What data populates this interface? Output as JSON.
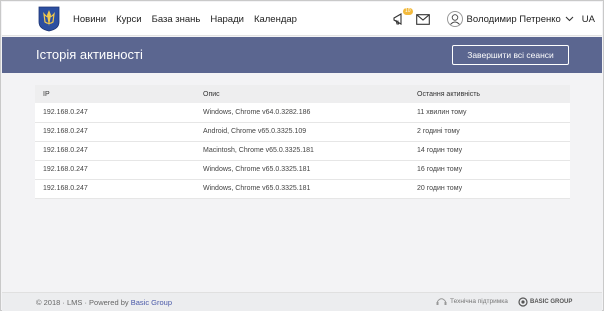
{
  "header": {
    "nav": [
      "Новини",
      "Курси",
      "База знань",
      "Наради",
      "Календар"
    ],
    "notifications_count": "10",
    "user_name": "Володимир Петренко",
    "lang": "UA"
  },
  "banner": {
    "title": "Історія активності",
    "end_sessions_label": "Завершити всі сеанси"
  },
  "table": {
    "headers": [
      "IP",
      "Опис",
      "Остання активність"
    ],
    "rows": [
      [
        "192.168.0.247",
        "Windows, Chrome v64.0.3282.186",
        "11 хвилин тому"
      ],
      [
        "192.168.0.247",
        "Android, Chrome v65.0.3325.109",
        "2 годині тому"
      ],
      [
        "192.168.0.247",
        "Macintosh, Chrome v65.0.3325.181",
        "14 годин тому"
      ],
      [
        "192.168.0.247",
        "Windows, Chrome v65.0.3325.181",
        "16 годин тому"
      ],
      [
        "192.168.0.247",
        "Windows, Chrome v65.0.3325.181",
        "20 годин тому"
      ]
    ]
  },
  "footer": {
    "copyright": "© 2018 · LMS · Powered by ",
    "powered_link": "Basic Group",
    "support": "Технічна підтримка",
    "brand": "BASIC GROUP"
  },
  "colors": {
    "banner": "#5b6690",
    "badge": "#f2b93b",
    "link": "#4a59a8"
  }
}
